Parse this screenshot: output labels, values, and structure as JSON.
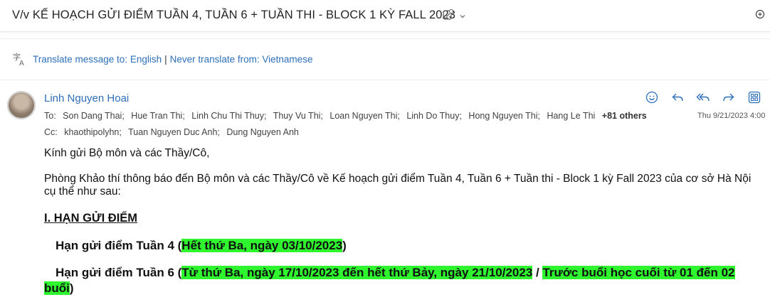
{
  "subject": {
    "title": "V/v KẾ HOẠCH GỬI ĐIỂM TUẦN 4, TUẦN 6 + TUẦN THI - BLOCK 1 KỲ FALL 2023"
  },
  "translate": {
    "link1": "Translate message to: English",
    "separator": "|",
    "link2": "Never translate from: Vietnamese"
  },
  "message": {
    "sender": "Linh Nguyen Hoai",
    "to_label": "To:",
    "to": [
      "Son Dang Thai;",
      "Hue Tran Thi;",
      "Linh Chu Thi Thuy;",
      "Thuy Vu Thi;",
      "Loan Nguyen Thi;",
      "Linh Do Thuy;",
      "Hong Nguyen Thi;",
      "Hang Le Thi"
    ],
    "others": "+81 others",
    "date": "Thu 9/21/2023 4:00",
    "cc_label": "Cc:",
    "cc": [
      "khaothipolyhn;",
      "Tuan Nguyen Duc Anh;",
      "Dung Nguyen Anh"
    ]
  },
  "body": {
    "greeting": "Kính gửi Bộ môn và các Thầy/Cô,",
    "intro": "Phòng Khảo thí thông báo đến Bộ môn và các Thầy/Cô về Kế hoạch gửi điểm Tuần 4, Tuần 6 + Tuần thi - Block 1 kỳ Fall 2023 của cơ sở Hà Nội cụ thể như sau:",
    "heading": "I. HẠN GỬI ĐIỂM",
    "line1_prefix": "Hạn gửi điểm Tuần 4 (",
    "line1_highlight": "Hết thứ Ba, ngày 03/10/2023",
    "line1_suffix": ")",
    "line2_prefix": "Hạn gửi điểm Tuần 6 (",
    "line2_highlight1": "Từ thứ Ba, ngày 17/10/2023 đến hết thứ Bảy, ngày 21/10/2023",
    "line2_mid": " / ",
    "line2_highlight2": "Trước buổi học cuối từ 01 đến 02 buổi",
    "line2_suffix": ")"
  },
  "colors": {
    "link": "#2d6fb8",
    "highlight": "#2ef52e"
  }
}
